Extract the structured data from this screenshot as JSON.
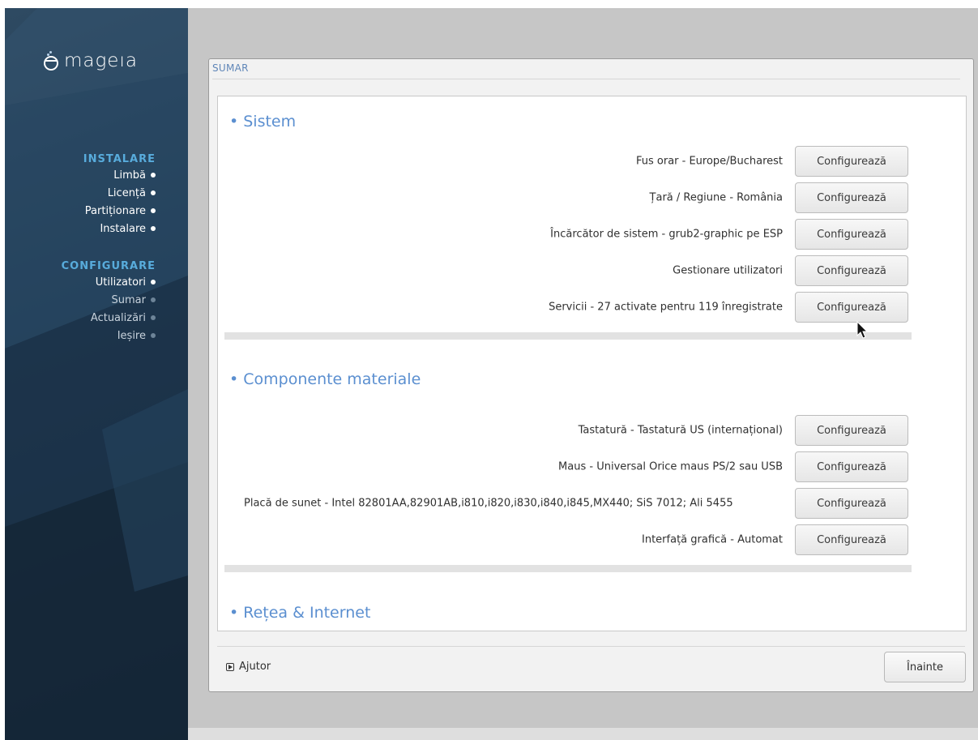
{
  "app": {
    "logo_text": "mageıa"
  },
  "sidebar": {
    "groups": [
      {
        "title": "INSTALARE",
        "items": [
          {
            "label": "Limbă",
            "state": "done"
          },
          {
            "label": "Licență",
            "state": "done"
          },
          {
            "label": "Partiționare",
            "state": "done"
          },
          {
            "label": "Instalare",
            "state": "done"
          }
        ]
      },
      {
        "title": "CONFIGURARE",
        "items": [
          {
            "label": "Utilizatori",
            "state": "done"
          },
          {
            "label": "Sumar",
            "state": "pending"
          },
          {
            "label": "Actualizări",
            "state": "pending"
          },
          {
            "label": "Ieșire",
            "state": "pending"
          }
        ]
      }
    ]
  },
  "panel": {
    "title": "SUMAR"
  },
  "sections": [
    {
      "title": "• Sistem",
      "rows": [
        {
          "label": "Fus orar - Europe/Bucharest",
          "button": "Configurează"
        },
        {
          "label": "Țară / Regiune - România",
          "button": "Configurează"
        },
        {
          "label": "Încărcător de sistem - grub2-graphic pe ESP",
          "button": "Configurează"
        },
        {
          "label": "Gestionare utilizatori",
          "button": "Configurează"
        },
        {
          "label": "Servicii - 27 activate pentru 119 înregistrate",
          "button": "Configurează"
        }
      ]
    },
    {
      "title": "• Componente materiale",
      "rows": [
        {
          "label": "Tastatură - Tastatură US (internațional)",
          "button": "Configurează"
        },
        {
          "label": "Maus - Universal Orice maus PS/2 sau USB",
          "button": "Configurează"
        },
        {
          "label": "Placă de sunet - Intel 82801AA,82901AB,i810,i820,i830,i840,i845,MX440; SiS 7012; Ali 5455",
          "button": "Configurează"
        },
        {
          "label": "Interfață grafică - Automat",
          "button": "Configurează"
        }
      ]
    },
    {
      "title": "• Rețea & Internet",
      "rows": []
    }
  ],
  "footer": {
    "help_label": "Ajutor",
    "next_label": "Înainte"
  },
  "colors": {
    "accent": "#5b8fd0",
    "sidebar_heading": "#58acdc",
    "sidebar_bg": "#1f3950"
  }
}
